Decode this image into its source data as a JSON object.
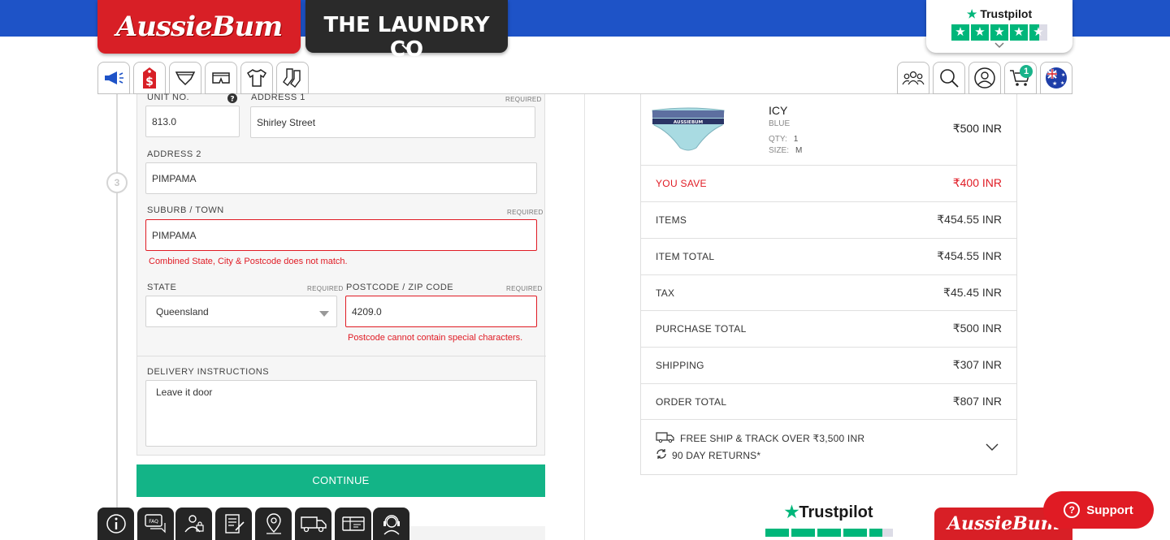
{
  "header": {
    "brand_primary": "AussieBum",
    "brand_secondary": "THE LAUNDRY CO",
    "trustpilot_label": "Trustpilot",
    "colors": {
      "topbar": "#1e53c7",
      "brand_red": "#d81f26",
      "trust_green": "#00b67a",
      "accent_green": "#13b487",
      "error": "#e01b24"
    }
  },
  "nav": {
    "left_icons": [
      "megaphone-icon",
      "price-tag-icon",
      "brief-icon",
      "trunk-icon",
      "tshirt-icon",
      "socks-icon"
    ],
    "right_icons": [
      "community-icon",
      "search-icon",
      "account-icon",
      "cart-icon",
      "australia-flag-icon"
    ],
    "cart_count": "1"
  },
  "form": {
    "step_number": "3",
    "unit_label": "Unit No.",
    "unit_value": "813.0",
    "address1_label": "Address 1",
    "address1_required": "Required",
    "address1_value": "Shirley Street",
    "address2_label": "Address 2",
    "address2_value": "PIMPAMA",
    "suburb_label": "Suburb / Town",
    "suburb_required": "Required",
    "suburb_value": "PIMPAMA",
    "suburb_error": "Combined State, City & Postcode does not match.",
    "state_label": "State",
    "state_required": "Required",
    "state_value": "Queensland",
    "postcode_label": "Postcode / Zip Code",
    "postcode_required": "Required",
    "postcode_value": "4209.0",
    "postcode_error": "Postcode cannot contain special characters.",
    "delivery_label": "Delivery Instructions",
    "delivery_value": "Leave it door",
    "continue_label": "Continue"
  },
  "summary": {
    "product": {
      "name": "ICY",
      "color": "Blue",
      "qty_label": "QTY:",
      "qty": "1",
      "size_label": "SIZE:",
      "size": "M",
      "price": "₹500 INR",
      "image_text": "AUSSIEBUM"
    },
    "rows": [
      {
        "label": "You Save",
        "value": "₹400 INR"
      },
      {
        "label": "Items",
        "value": "₹454.55 INR"
      },
      {
        "label": "Item Total",
        "value": "₹454.55 INR"
      },
      {
        "label": "Tax",
        "value": "₹45.45 INR"
      },
      {
        "label": "Purchase Total",
        "value": "₹500 INR"
      },
      {
        "label": "Shipping",
        "value": "₹307 INR"
      },
      {
        "label": "Order Total",
        "value": "₹807 INR"
      }
    ],
    "perk_shipping": "Free ship & track over ₹3,500 INR",
    "perk_returns": "90 day returns*"
  },
  "footer": {
    "trustpilot_label": "Trustpilot",
    "badge_label": "AussieBum",
    "support_label": "Support",
    "bottom_icons": [
      "info-icon",
      "faq-icon",
      "privacy-icon",
      "terms-icon",
      "store-locator-icon",
      "delivery-truck-icon",
      "gift-card-icon",
      "customer-service-icon"
    ]
  }
}
